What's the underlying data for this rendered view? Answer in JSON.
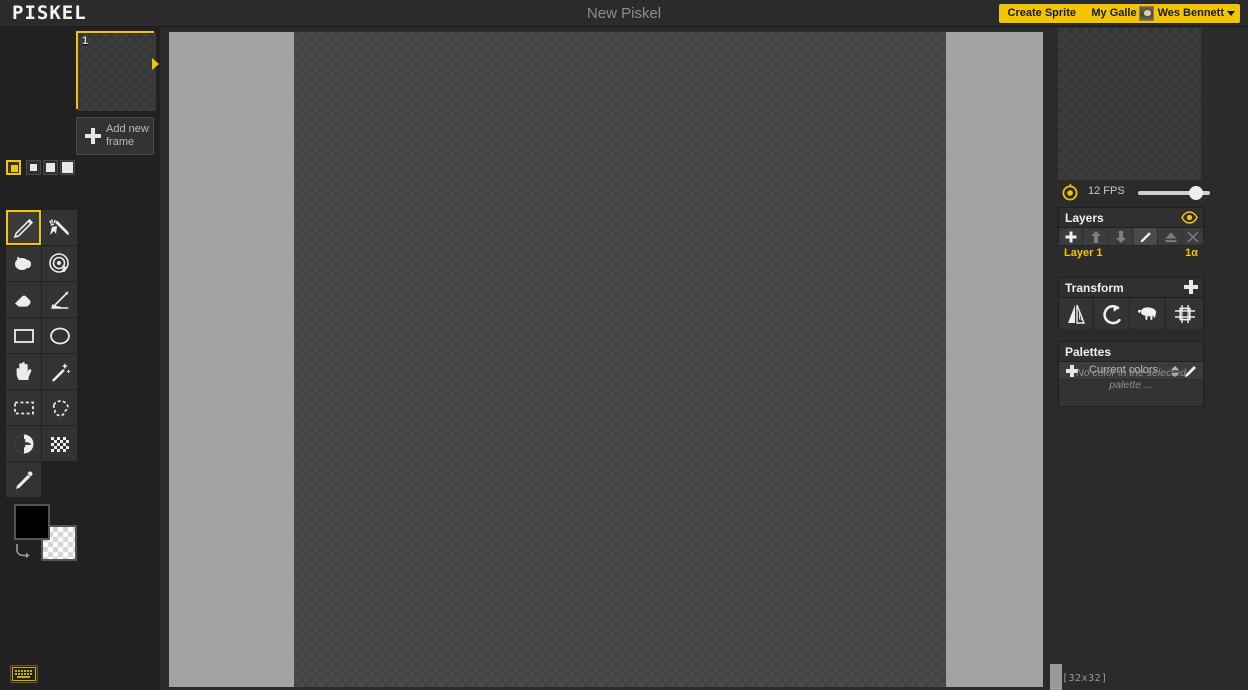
{
  "header": {
    "logo": "PISKEL",
    "doc_title": "New Piskel",
    "create_sprite": "Create Sprite",
    "my_gallery": "My Gallery",
    "user_name": "Wes Bennett"
  },
  "frames": {
    "items": [
      {
        "number": "1"
      }
    ],
    "add_label": "Add new\nframe",
    "add_label_line1": "Add new",
    "add_label_line2": "frame"
  },
  "size_selector": {
    "options": [
      "size-xs",
      "size-s",
      "size-m",
      "size-l"
    ],
    "selected_index": 0
  },
  "tools": [
    {
      "name": "pen-tool",
      "selected": true
    },
    {
      "name": "vertical-mirror-pen-tool",
      "selected": false
    },
    {
      "name": "paint-bucket-tool",
      "selected": false
    },
    {
      "name": "paint-all-similar-pixels-tool",
      "selected": false
    },
    {
      "name": "eraser-tool",
      "selected": false
    },
    {
      "name": "stroke-tool",
      "selected": false
    },
    {
      "name": "rectangle-tool",
      "selected": false
    },
    {
      "name": "circle-tool",
      "selected": false
    },
    {
      "name": "move-tool",
      "selected": false
    },
    {
      "name": "magic-wand-tool",
      "selected": false
    },
    {
      "name": "rectangle-select-tool",
      "selected": false
    },
    {
      "name": "lasso-select-tool",
      "selected": false
    },
    {
      "name": "shape-select-tool",
      "selected": false
    },
    {
      "name": "dithering-tool",
      "selected": false
    },
    {
      "name": "color-picker-tool",
      "selected": false
    }
  ],
  "colors": {
    "primary": "#000000",
    "secondary": "transparent"
  },
  "canvas": {
    "size_readout": "[32x32]",
    "background_color": "#a2a2a2"
  },
  "preview": {
    "fps_label": "12 FPS",
    "fps_value": 12,
    "slider_percent": 70
  },
  "layers": {
    "title": "Layers",
    "buttons": [
      "add-layer",
      "move-layer-up",
      "move-layer-down",
      "rename-layer",
      "merge-layer-down",
      "delete-layer"
    ],
    "rows": [
      {
        "name": "Layer 1",
        "opacity": "1α"
      }
    ]
  },
  "transform": {
    "title": "Transform",
    "buttons": [
      "flip-horizontal",
      "rotate",
      "clone",
      "center"
    ]
  },
  "palettes": {
    "title": "Palettes",
    "selected_palette": "Current colors",
    "empty_message": "No color in the selected palette ..."
  },
  "rail": {
    "buttons": [
      "settings",
      "resize",
      "save",
      "export-image",
      "open-file"
    ]
  },
  "theme": {
    "accent": "#f2c500",
    "panel_bg": "#333333",
    "app_bg": "#2b2b2b",
    "left_bg": "#212121"
  }
}
